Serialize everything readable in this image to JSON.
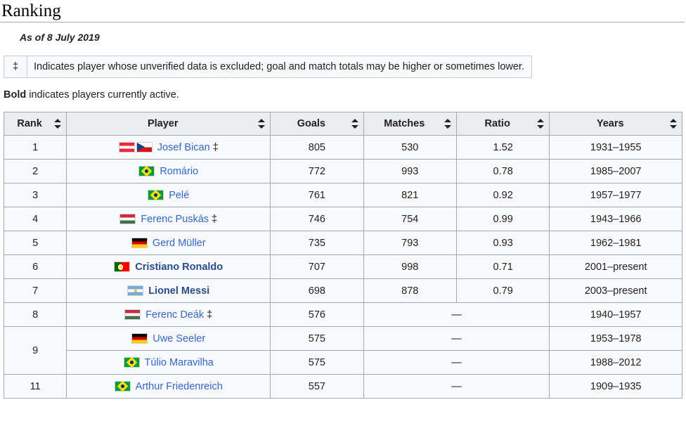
{
  "heading": "Ranking",
  "as_of": "As of 8 July 2019",
  "note": {
    "symbol": "‡",
    "text": "Indicates player whose unverified data is excluded; goal and match totals may be higher or sometimes lower."
  },
  "bold_note": {
    "bold": "Bold",
    "rest": " indicates players currently active."
  },
  "colors": {
    "link": "#3366cc",
    "link_active": "#2a4b8d",
    "header_bg": "#eaecf0",
    "row_bg": "#f8f9fa",
    "border": "#a2a9b1"
  },
  "table": {
    "columns": [
      {
        "label": "Rank",
        "sortable": true
      },
      {
        "label": "Player",
        "sortable": true
      },
      {
        "label": "Goals",
        "sortable": true
      },
      {
        "label": "Matches",
        "sortable": true
      },
      {
        "label": "Ratio",
        "sortable": true
      },
      {
        "label": "Years",
        "sortable": true
      }
    ],
    "rows": [
      {
        "rank": "1",
        "player": "Josef Bican",
        "flags": [
          "austria",
          "czech"
        ],
        "dagger": "‡",
        "active": false,
        "goals": "805",
        "matches": "530",
        "ratio": "1.52",
        "merged": false,
        "years": "1931–1955"
      },
      {
        "rank": "2",
        "player": "Romário",
        "flags": [
          "brazil"
        ],
        "dagger": "",
        "active": false,
        "goals": "772",
        "matches": "993",
        "ratio": "0.78",
        "merged": false,
        "years": "1985–2007"
      },
      {
        "rank": "3",
        "player": "Pelé",
        "flags": [
          "brazil"
        ],
        "dagger": "",
        "active": false,
        "goals": "761",
        "matches": "821",
        "ratio": "0.92",
        "merged": false,
        "years": "1957–1977"
      },
      {
        "rank": "4",
        "player": "Ferenc Puskás",
        "flags": [
          "hungary"
        ],
        "dagger": "‡",
        "active": false,
        "goals": "746",
        "matches": "754",
        "ratio": "0.99",
        "merged": false,
        "years": "1943–1966"
      },
      {
        "rank": "5",
        "player": "Gerd Müller",
        "flags": [
          "germany"
        ],
        "dagger": "",
        "active": false,
        "goals": "735",
        "matches": "793",
        "ratio": "0.93",
        "merged": false,
        "years": "1962–1981"
      },
      {
        "rank": "6",
        "player": "Cristiano Ronaldo",
        "flags": [
          "portugal"
        ],
        "dagger": "",
        "active": true,
        "goals": "707",
        "matches": "998",
        "ratio": "0.71",
        "merged": false,
        "years": "2001–present"
      },
      {
        "rank": "7",
        "player": "Lionel Messi",
        "flags": [
          "argentina"
        ],
        "dagger": "",
        "active": true,
        "goals": "698",
        "matches": "878",
        "ratio": "0.79",
        "merged": false,
        "years": "2003–present"
      },
      {
        "rank": "8",
        "player": "Ferenc Deák",
        "flags": [
          "hungary"
        ],
        "dagger": "‡",
        "active": false,
        "goals": "576",
        "merged": true,
        "merged_value": "—",
        "years": "1940–1957"
      },
      {
        "rank": "9",
        "rank_rowspan": 2,
        "player": "Uwe Seeler",
        "flags": [
          "germany"
        ],
        "dagger": "",
        "active": false,
        "goals": "575",
        "merged": true,
        "merged_value": "—",
        "years": "1953–1978"
      },
      {
        "rank": "",
        "rank_hidden": true,
        "player": "Túlio Maravilha",
        "flags": [
          "brazil"
        ],
        "dagger": "",
        "active": false,
        "goals": "575",
        "merged": true,
        "merged_value": "—",
        "years": "1988–2012"
      },
      {
        "rank": "11",
        "player": "Arthur Friedenreich",
        "flags": [
          "brazil"
        ],
        "dagger": "",
        "active": false,
        "goals": "557",
        "merged": true,
        "merged_value": "—",
        "years": "1909–1935"
      }
    ]
  }
}
